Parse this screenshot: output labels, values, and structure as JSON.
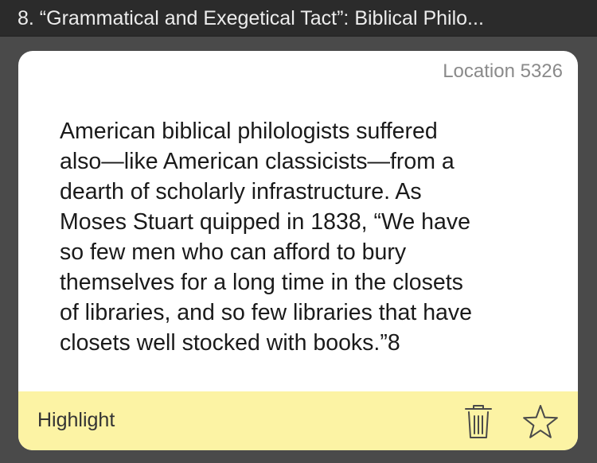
{
  "header": {
    "chapter_title": "8. “Grammatical and Exegetical Tact”: Biblical Philo..."
  },
  "card": {
    "location": "Location 5326",
    "quote_text": "American biblical philologists suffered\nalso—like American classicists—from a\ndearth of scholarly infrastructure. As\nMoses Stuart quipped in 1838, “We have\nso few men who can afford to bury\nthemselves for a long time in the closets\nof libraries, and so few libraries that have\nclosets well stocked with books.”8"
  },
  "footer": {
    "highlight_label": "Highlight",
    "icons": [
      "trash-icon",
      "star-icon"
    ]
  },
  "colors": {
    "page_background": "#4a4a4a",
    "header_background": "#2b2b2b",
    "card_background": "#ffffff",
    "highlight_bar": "#fcf3a4",
    "icon_color": "#4a4a4a"
  }
}
